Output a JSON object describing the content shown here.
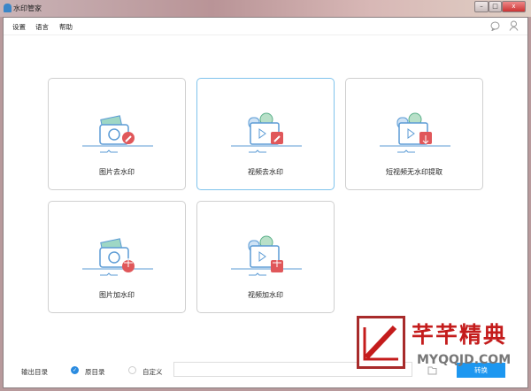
{
  "window": {
    "title": "水印管家",
    "minimize": "–",
    "maximize": "□",
    "close": "x"
  },
  "menu": {
    "items": [
      "设置",
      "语言",
      "帮助"
    ]
  },
  "cards": [
    {
      "label": "图片去水印",
      "icon": "camera-eraser-icon"
    },
    {
      "label": "视频去水印",
      "icon": "video-eraser-icon"
    },
    {
      "label": "短视频无水印提取",
      "icon": "video-download-icon"
    },
    {
      "label": "图片加水印",
      "icon": "camera-add-icon"
    },
    {
      "label": "视频加水印",
      "icon": "video-add-icon"
    }
  ],
  "bottom": {
    "output_label": "输出目录",
    "option_original": "原目录",
    "option_custom": "自定义",
    "path_value": "",
    "convert_label": "转换",
    "selected": "原目录"
  },
  "watermark": {
    "cn": "芊芊精典",
    "en": "MYQQJD.COM"
  },
  "colors": {
    "accent": "#1d97f0",
    "icon_blue": "#5b9bd5",
    "icon_red": "#e0575a"
  }
}
